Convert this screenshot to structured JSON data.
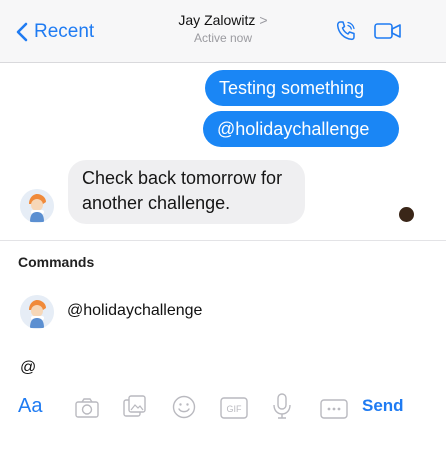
{
  "header": {
    "back_label": "Recent",
    "title": "Jay Zalowitz",
    "title_chevron": ">",
    "status": "Active now",
    "icons": [
      "phone-icon",
      "video-icon"
    ]
  },
  "messages": {
    "outgoing": [
      "Testing something",
      "@holidaychallenge"
    ],
    "incoming": "Check back tomorrow for another challenge."
  },
  "commands": {
    "heading": "Commands",
    "items": [
      {
        "label": "@holidaychallenge"
      }
    ]
  },
  "composer": {
    "text": "@",
    "aa_label": "Aa",
    "send_label": "Send",
    "icons": [
      "camera-icon",
      "gallery-icon",
      "emoji-icon",
      "gif-icon",
      "microphone-icon",
      "more-icon"
    ]
  },
  "colors": {
    "accent": "#1a86f5",
    "incoming_bubble": "#efeff1"
  }
}
